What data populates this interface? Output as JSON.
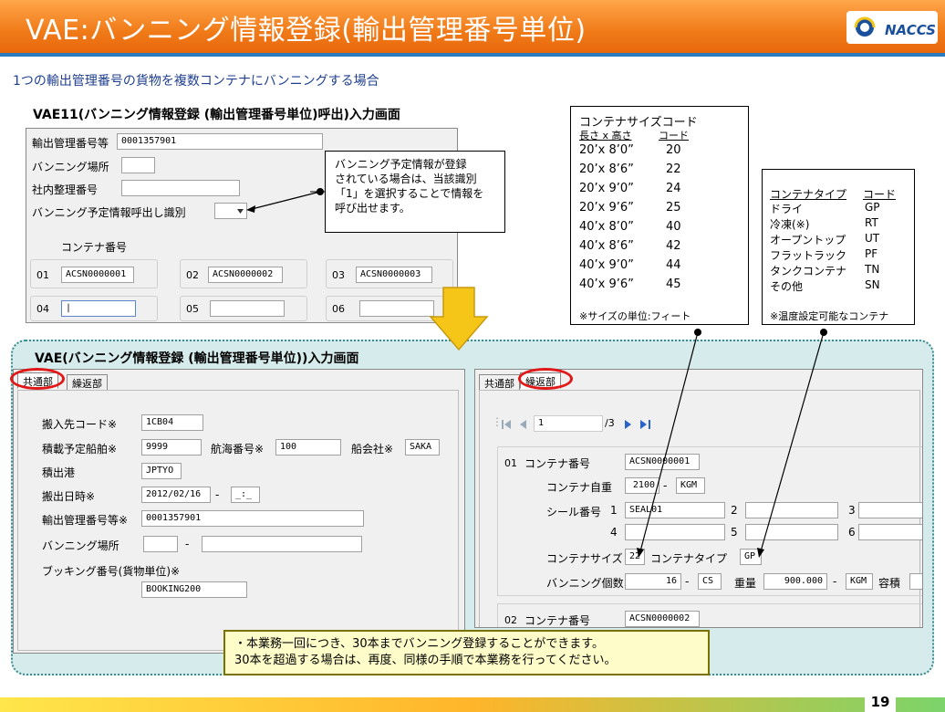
{
  "header": {
    "title": "VAE:バンニング情報登録(輸出管理番号単位)",
    "logo_text": "NACCS"
  },
  "subtitle": "1つの輸出管理番号の貨物を複数コンテナにバンニングする場合",
  "vae11": {
    "heading": "VAE11(バンニング情報登録 (輸出管理番号単位)呼出)入力画面",
    "export_no_label": "輸出管理番号等",
    "export_no_value": "0001357901",
    "vanning_place_label": "バンニング場所",
    "internal_no_label": "社内整理番号",
    "call_id_label": "バンニング予定情報呼出し識別",
    "container_no_label": "コンテナ番号",
    "containers": [
      {
        "idx": "01",
        "value": "ACSN0000001"
      },
      {
        "idx": "02",
        "value": "ACSN0000002"
      },
      {
        "idx": "03",
        "value": "ACSN0000003"
      },
      {
        "idx": "04",
        "value": "|"
      },
      {
        "idx": "05",
        "value": ""
      },
      {
        "idx": "06",
        "value": ""
      }
    ]
  },
  "callout": {
    "line1": "バンニング予定情報が登録",
    "line2": "されている場合は、当該識別",
    "line3": "「1」を選択することで情報を",
    "line4": "呼び出せます。"
  },
  "size_codes": {
    "title": "コンテナサイズコード",
    "col1": "長さ x 高さ",
    "col2": "コード",
    "rows": [
      {
        "size": "20’x 8’0”",
        "code": "20"
      },
      {
        "size": "20’x 8’6”",
        "code": "22"
      },
      {
        "size": "20’x 9’0”",
        "code": "24"
      },
      {
        "size": "20’x 9’6”",
        "code": "25"
      },
      {
        "size": "40’x 8’0”",
        "code": "40"
      },
      {
        "size": "40’x 8’6”",
        "code": "42"
      },
      {
        "size": "40’x 9’0”",
        "code": "44"
      },
      {
        "size": "40’x 9’6”",
        "code": "45"
      }
    ],
    "note": "※サイズの単位:フィート"
  },
  "type_codes": {
    "col1": "コンテナタイプ",
    "col2": "コード",
    "rows": [
      {
        "type": "ドライ",
        "code": "GP"
      },
      {
        "type": "冷凍(※)",
        "code": "RT"
      },
      {
        "type": "オープントップ",
        "code": "UT"
      },
      {
        "type": "フラットラック",
        "code": "PF"
      },
      {
        "type": "タンクコンテナ",
        "code": "TN"
      },
      {
        "type": "その他",
        "code": "SN"
      }
    ],
    "note": "※温度設定可能なコンテナ"
  },
  "vae": {
    "heading": "VAE(バンニング情報登録 (輸出管理番号単位))入力画面",
    "tab_common": "共通部",
    "tab_repeat": "繰返部",
    "carry_in_label": "搬入先コード※",
    "carry_in_value": "1CB04",
    "ship_label": "積載予定船舶※",
    "ship_value": "9999",
    "voyage_label": "航海番号※",
    "voyage_value": "100",
    "line_label": "船会社※",
    "line_value": "SAKA",
    "port_label": "積出港",
    "port_value": "JPTYO",
    "out_date_label": "搬出日時※",
    "out_date_value": "2012/02/16",
    "out_date_sep": "-",
    "out_time_value": "_:_",
    "export_no_label": "輸出管理番号等※",
    "export_no_value": "0001357901",
    "vanning_place_label": "バンニング場所",
    "vanning_place_sep": "-",
    "booking_label": "ブッキング番号(貨物単位)※",
    "booking_value": "BOOKING200"
  },
  "repeat": {
    "tab_common": "共通部",
    "tab_repeat": "繰返部",
    "nav_page": "1",
    "nav_total": "/3",
    "row1_idx": "01",
    "container_no_label": "コンテナ番号",
    "container_no_value": "ACSN0000001",
    "tare_label": "コンテナ自重",
    "tare_value": "2100",
    "tare_sep": "-",
    "tare_unit": "KGM",
    "seal_label": "シール番号",
    "seal_1_no": "1",
    "seal_1_value": "SEAL01",
    "seal_2_no": "2",
    "seal_3_no": "3",
    "seal_4_no": "4",
    "seal_5_no": "5",
    "seal_6_no": "6",
    "size_label": "コンテナサイズ",
    "size_value": "22",
    "type_label": "コンテナタイプ",
    "type_value": "GP",
    "count_label": "バンニング個数",
    "count_value": "16",
    "count_sep": "-",
    "count_unit": "CS",
    "weight_label": "重量",
    "weight_value": "900.000",
    "weight_sep": "-",
    "weight_unit": "KGM",
    "volume_label": "容積",
    "row2_idx": "02",
    "row2_container_value": "ACSN0000002"
  },
  "note": {
    "line1": "・本業務一回につき、30本までバンニング登録することができます。",
    "line2": "30本を超過する場合は、再度、同様の手順で本業務を行ってください。"
  },
  "page_number": "19",
  "colors": {
    "header_orange": "#f07a18",
    "accent_blue": "#1f3f8f",
    "oval_red": "#e01818",
    "region_teal": "#d6ecec",
    "arrow_yellow": "#f5c518"
  }
}
